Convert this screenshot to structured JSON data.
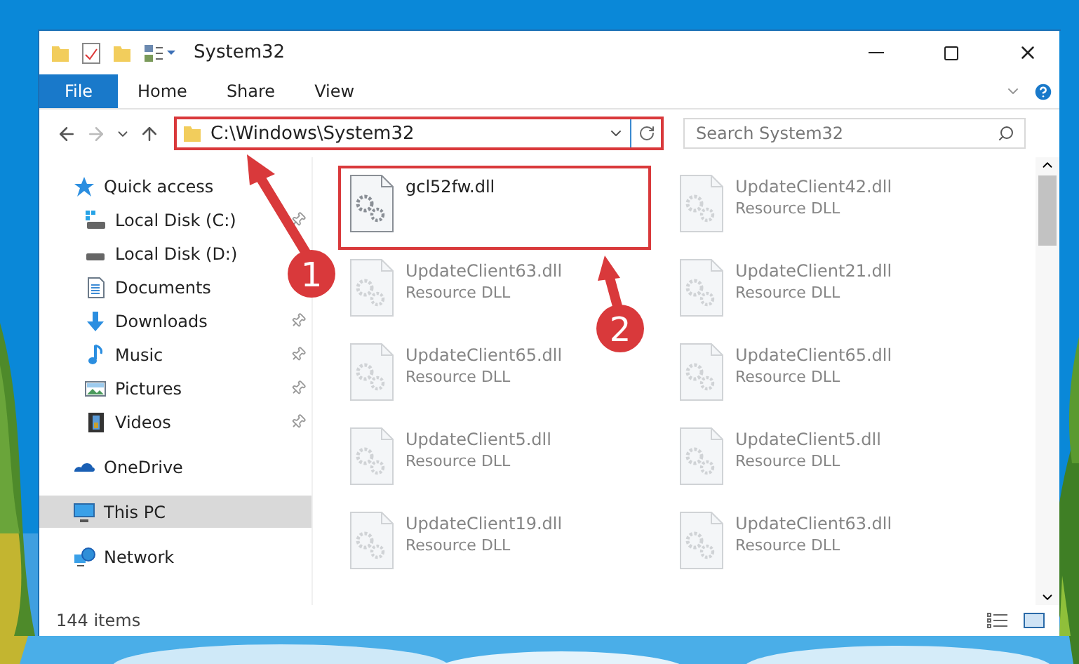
{
  "window": {
    "title": "System32"
  },
  "ribbon": {
    "tabs": [
      {
        "label": "File",
        "kind": "file"
      },
      {
        "label": "Home",
        "kind": "plain"
      },
      {
        "label": "Share",
        "kind": "plain"
      },
      {
        "label": "View",
        "kind": "plain"
      }
    ]
  },
  "address": {
    "path": "C:\\Windows\\System32",
    "highlighted": true
  },
  "search": {
    "placeholder": "Search System32"
  },
  "sidebar": {
    "items": [
      {
        "label": "Quick access",
        "kind": "star",
        "selected": false,
        "pinned": false,
        "children": [
          {
            "label": "Local Disk (C:)",
            "kind": "disk-c",
            "selected": false,
            "pinned": true
          },
          {
            "label": "Local Disk (D:)",
            "kind": "disk",
            "selected": false,
            "pinned": false
          },
          {
            "label": "Documents",
            "kind": "documents",
            "selected": false,
            "pinned": false
          },
          {
            "label": "Downloads",
            "kind": "downloads",
            "selected": false,
            "pinned": true
          },
          {
            "label": "Music",
            "kind": "music",
            "selected": false,
            "pinned": true
          },
          {
            "label": "Pictures",
            "kind": "pictures",
            "selected": false,
            "pinned": true
          },
          {
            "label": "Videos",
            "kind": "videos",
            "selected": false,
            "pinned": true
          }
        ]
      },
      {
        "label": "OneDrive",
        "kind": "cloud",
        "selected": false,
        "pinned": false
      },
      {
        "label": "This PC",
        "kind": "pc",
        "selected": true,
        "pinned": false
      },
      {
        "label": "Network",
        "kind": "network",
        "selected": false,
        "pinned": false
      }
    ]
  },
  "files": [
    {
      "name": "gcl52fw.dll",
      "highlighted": true,
      "blurred": false
    },
    {
      "name": "UpdateClient42.dll",
      "subtitle": "Resource DLL",
      "highlighted": false,
      "blurred": true
    },
    {
      "name": "UpdateClient63.dll",
      "subtitle": "Resource DLL",
      "highlighted": false,
      "blurred": true
    },
    {
      "name": "UpdateClient21.dll",
      "subtitle": "Resource DLL",
      "highlighted": false,
      "blurred": true
    },
    {
      "name": "UpdateClient65.dll",
      "subtitle": "Resource DLL",
      "highlighted": false,
      "blurred": true
    },
    {
      "name": "UpdateClient65.dll",
      "subtitle": "Resource DLL",
      "highlighted": false,
      "blurred": true
    },
    {
      "name": "UpdateClient5.dll",
      "subtitle": "Resource DLL",
      "highlighted": false,
      "blurred": true
    },
    {
      "name": "UpdateClient5.dll",
      "subtitle": "Resource DLL",
      "highlighted": false,
      "blurred": true
    },
    {
      "name": "UpdateClient19.dll",
      "subtitle": "Resource DLL",
      "highlighted": false,
      "blurred": true
    },
    {
      "name": "UpdateClient63.dll",
      "subtitle": "Resource DLL",
      "highlighted": false,
      "blurred": true
    }
  ],
  "status_bar": {
    "count": "144 items"
  },
  "callouts": [
    {
      "number": "1"
    },
    {
      "number": "2"
    }
  ]
}
